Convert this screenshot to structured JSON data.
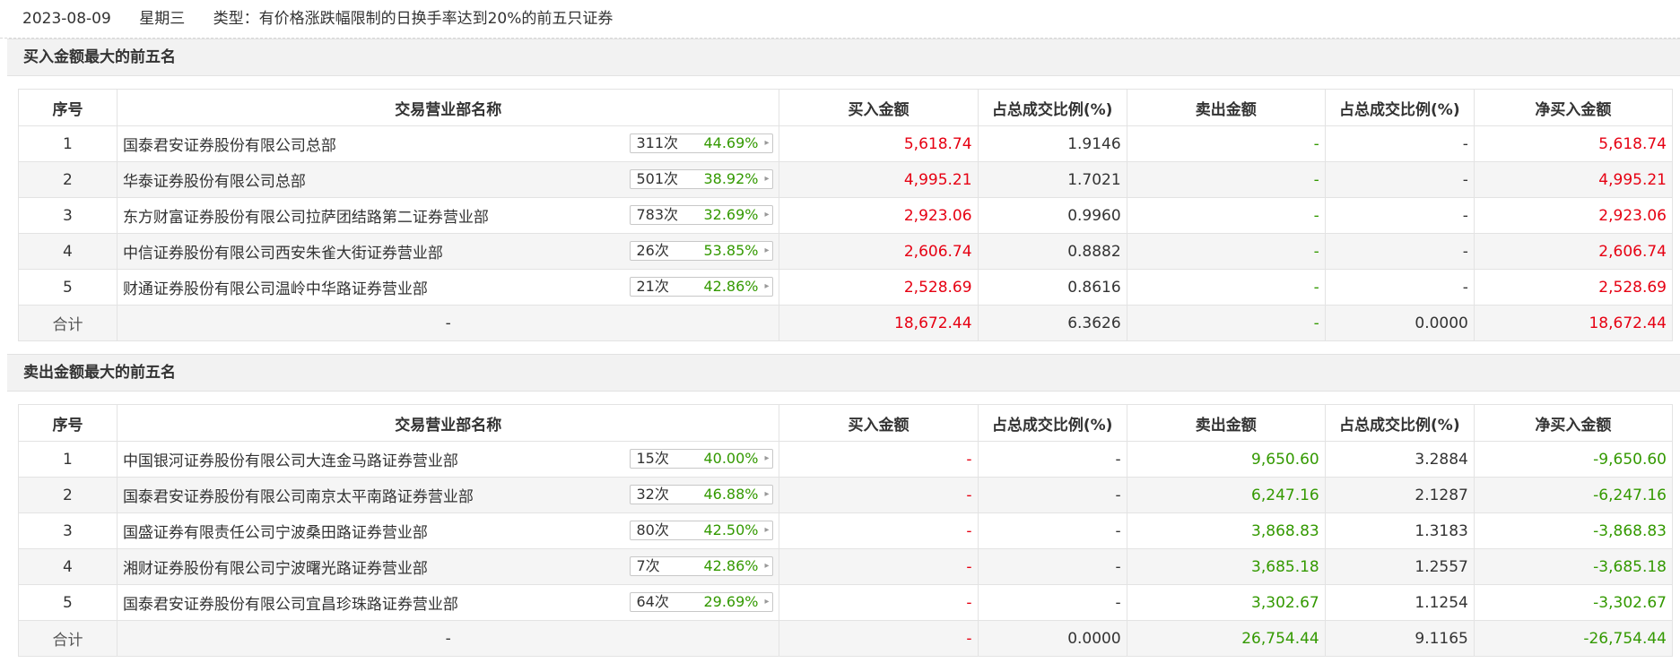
{
  "header": {
    "date": "2023-08-09",
    "weekday": "星期三",
    "type_text": "类型：有价格涨跌幅限制的日换手率达到20%的前五只证券"
  },
  "columns": [
    "序号",
    "交易营业部名称",
    "买入金额",
    "占总成交比例(%)",
    "卖出金额",
    "占总成交比例(%)",
    "净买入金额"
  ],
  "buy_section": {
    "title": "买入金额最大的前五名",
    "rows": [
      {
        "idx": "1",
        "name": "国泰君安证券股份有限公司总部",
        "count": "311次",
        "pct": "44.69%",
        "buy": "5,618.74",
        "buy_ratio": "1.9146",
        "sell": "-",
        "sell_ratio": "-",
        "net": "5,618.74"
      },
      {
        "idx": "2",
        "name": "华泰证券股份有限公司总部",
        "count": "501次",
        "pct": "38.92%",
        "buy": "4,995.21",
        "buy_ratio": "1.7021",
        "sell": "-",
        "sell_ratio": "-",
        "net": "4,995.21"
      },
      {
        "idx": "3",
        "name": "东方财富证券股份有限公司拉萨团结路第二证券营业部",
        "count": "783次",
        "pct": "32.69%",
        "buy": "2,923.06",
        "buy_ratio": "0.9960",
        "sell": "-",
        "sell_ratio": "-",
        "net": "2,923.06"
      },
      {
        "idx": "4",
        "name": "中信证券股份有限公司西安朱雀大街证券营业部",
        "count": "26次",
        "pct": "53.85%",
        "buy": "2,606.74",
        "buy_ratio": "0.8882",
        "sell": "-",
        "sell_ratio": "-",
        "net": "2,606.74"
      },
      {
        "idx": "5",
        "name": "财通证券股份有限公司温岭中华路证券营业部",
        "count": "21次",
        "pct": "42.86%",
        "buy": "2,528.69",
        "buy_ratio": "0.8616",
        "sell": "-",
        "sell_ratio": "-",
        "net": "2,528.69"
      }
    ],
    "total": {
      "label": "合计",
      "name": "-",
      "buy": "18,672.44",
      "buy_ratio": "6.3626",
      "sell": "-",
      "sell_ratio": "0.0000",
      "net": "18,672.44"
    }
  },
  "sell_section": {
    "title": "卖出金额最大的前五名",
    "rows": [
      {
        "idx": "1",
        "name": "中国银河证券股份有限公司大连金马路证券营业部",
        "count": "15次",
        "pct": "40.00%",
        "buy": "-",
        "buy_ratio": "-",
        "sell": "9,650.60",
        "sell_ratio": "3.2884",
        "net": "-9,650.60"
      },
      {
        "idx": "2",
        "name": "国泰君安证券股份有限公司南京太平南路证券营业部",
        "count": "32次",
        "pct": "46.88%",
        "buy": "-",
        "buy_ratio": "-",
        "sell": "6,247.16",
        "sell_ratio": "2.1287",
        "net": "-6,247.16"
      },
      {
        "idx": "3",
        "name": "国盛证券有限责任公司宁波桑田路证券营业部",
        "count": "80次",
        "pct": "42.50%",
        "buy": "-",
        "buy_ratio": "-",
        "sell": "3,868.83",
        "sell_ratio": "1.3183",
        "net": "-3,868.83"
      },
      {
        "idx": "4",
        "name": "湘财证券股份有限公司宁波曙光路证券营业部",
        "count": "7次",
        "pct": "42.86%",
        "buy": "-",
        "buy_ratio": "-",
        "sell": "3,685.18",
        "sell_ratio": "1.2557",
        "net": "-3,685.18"
      },
      {
        "idx": "5",
        "name": "国泰君安证券股份有限公司宜昌珍珠路证券营业部",
        "count": "64次",
        "pct": "29.69%",
        "buy": "-",
        "buy_ratio": "-",
        "sell": "3,302.67",
        "sell_ratio": "1.1254",
        "net": "-3,302.67"
      }
    ],
    "total": {
      "label": "合计",
      "name": "-",
      "buy": "-",
      "buy_ratio": "0.0000",
      "sell": "26,754.44",
      "sell_ratio": "9.1165",
      "net": "-26,754.44"
    }
  },
  "colors": {
    "positive": "#e60012",
    "negative": "#339900",
    "row_alt": "#f5f5f5"
  },
  "icons": {
    "badge_arrow": "caret-right-icon"
  }
}
